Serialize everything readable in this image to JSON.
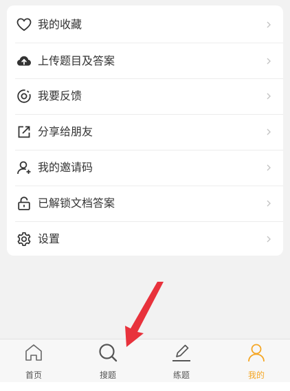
{
  "menu": {
    "items": [
      {
        "label": "我的收藏",
        "icon": "heart-icon"
      },
      {
        "label": "上传题目及答案",
        "icon": "cloud-upload-icon"
      },
      {
        "label": "我要反馈",
        "icon": "feedback-icon"
      },
      {
        "label": "分享给朋友",
        "icon": "share-icon"
      },
      {
        "label": "我的邀请码",
        "icon": "user-add-icon"
      },
      {
        "label": "已解锁文档答案",
        "icon": "unlock-icon"
      },
      {
        "label": "设置",
        "icon": "gear-icon"
      }
    ]
  },
  "tabbar": {
    "tabs": [
      {
        "label": "首页",
        "icon": "home-icon"
      },
      {
        "label": "搜题",
        "icon": "search-icon"
      },
      {
        "label": "练题",
        "icon": "pencil-icon"
      },
      {
        "label": "我的",
        "icon": "profile-icon",
        "active": true
      }
    ]
  },
  "colors": {
    "accent": "#f5a623",
    "annotation_arrow": "#e8323c"
  }
}
